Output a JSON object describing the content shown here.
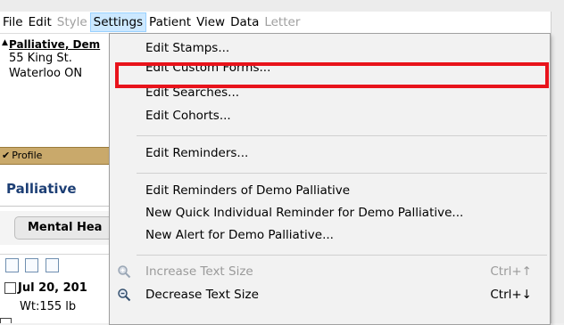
{
  "menubar": {
    "items": [
      "File",
      "Edit",
      "Style",
      "Settings",
      "Patient",
      "View",
      "Data",
      "Letter"
    ]
  },
  "patient": {
    "name": "Palliative, Dem",
    "address_line1": "55 King St.",
    "address_line2": "Waterloo ON"
  },
  "profile_label": "Profile",
  "section_title": "Palliative",
  "tab_label": "Mental Hea",
  "note": {
    "date": "Jul 20, 201",
    "weight": "Wt:155 lb"
  },
  "settings_menu": {
    "items": [
      {
        "label": "Edit Stamps..."
      },
      {
        "label": "Edit Custom Forms..."
      },
      {
        "label": "Edit Searches..."
      },
      {
        "label": "Edit Cohorts..."
      },
      {
        "label": "Edit Reminders..."
      },
      {
        "label": "Edit Reminders of Demo Palliative"
      },
      {
        "label": "New Quick Individual Reminder for Demo Palliative..."
      },
      {
        "label": "New Alert for Demo Palliative..."
      },
      {
        "label": "Increase Text Size",
        "shortcut": "Ctrl+↑",
        "icon": "zoom-in-icon"
      },
      {
        "label": "Decrease Text Size",
        "shortcut": "Ctrl+↓",
        "icon": "zoom-out-icon"
      }
    ]
  },
  "colors": {
    "highlight_border": "#e8131b",
    "menu_active_bg": "#cce8ff",
    "profile_bar": "#c9a96b",
    "title_blue": "#1d3f75"
  }
}
